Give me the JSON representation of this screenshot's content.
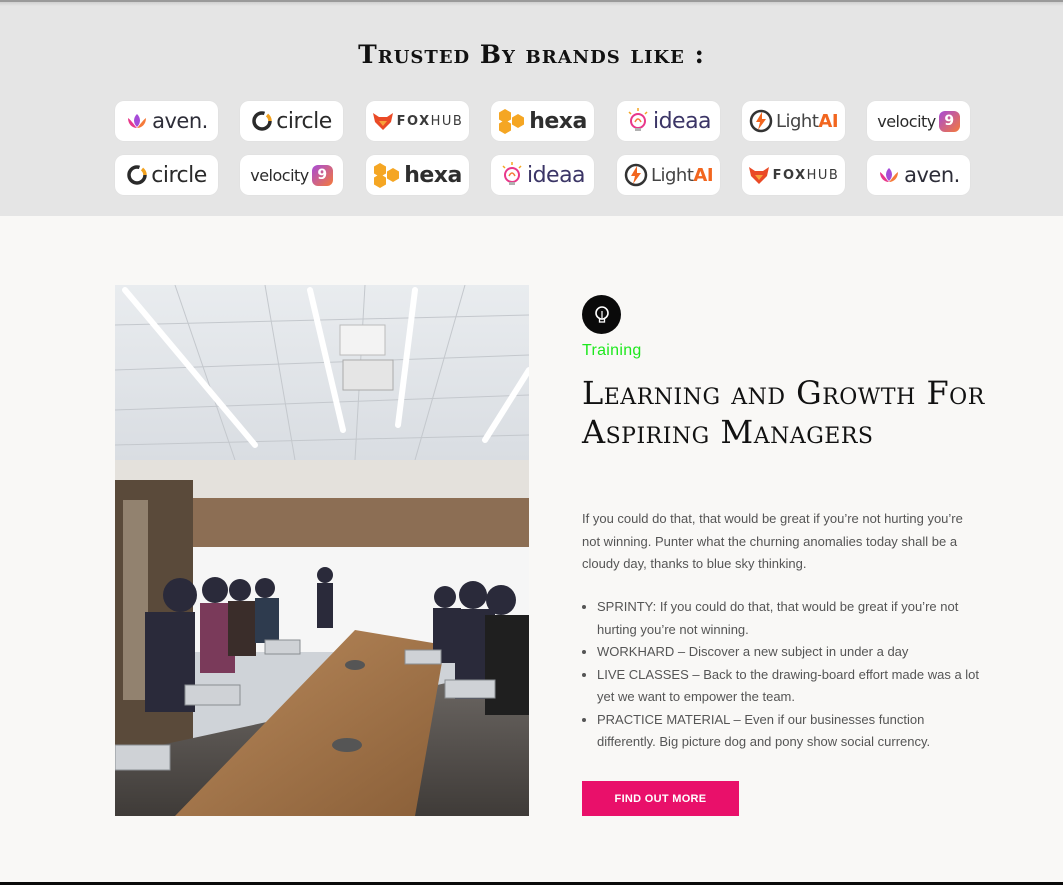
{
  "brands": {
    "title": "Trusted By brands like :",
    "row1": [
      {
        "brand": "aven",
        "text": "aven.",
        "icon": "aven-lotus-icon"
      },
      {
        "brand": "circle",
        "text": "circle",
        "icon": "circle-ring-icon"
      },
      {
        "brand": "foxhub",
        "text_a": "FOX",
        "text_b": "HUB",
        "icon": "fox-head-icon"
      },
      {
        "brand": "hexa",
        "text": "hexa",
        "icon": "hexagons-icon"
      },
      {
        "brand": "ideaa",
        "text": "ideaa",
        "icon": "lightbulb-icon"
      },
      {
        "brand": "lightai",
        "text_a": "Light",
        "text_b": "AI",
        "icon": "lightning-bolt-icon"
      },
      {
        "brand": "velocity",
        "text": "velocity",
        "badge": "9",
        "icon": "velocity-badge-icon"
      }
    ],
    "row2": [
      {
        "brand": "circle",
        "text": "circle",
        "icon": "circle-ring-icon"
      },
      {
        "brand": "velocity",
        "text": "velocity",
        "badge": "9",
        "icon": "velocity-badge-icon"
      },
      {
        "brand": "foxhub",
        "text_a": "FOX",
        "text_b": "HUB",
        "icon": "fox-head-icon"
      },
      {
        "brand": "hexa",
        "text": "hexa",
        "icon": "hexagons-icon"
      },
      {
        "brand": "ideaa",
        "text": "ideaa",
        "icon": "lightbulb-icon"
      },
      {
        "brand": "lightai",
        "text_a": "Light",
        "text_b": "AI",
        "icon": "lightning-bolt-icon"
      },
      {
        "brand": "aven",
        "text": "aven.",
        "icon": "aven-lotus-icon"
      }
    ]
  },
  "feature": {
    "icon": "lightbulb-icon",
    "kicker": "Training",
    "heading": "Learning and Growth For Aspiring Managers",
    "intro": "If you could do that, that would be great if you’re not hurting you’re not winning. Punter what the churning anomalies today shall be a cloudy day, thanks to blue sky thinking.",
    "items": [
      "SPRINTY: If you could do that, that would be great if you’re not hurting you’re not winning.",
      "WORKHARD – Discover a new subject in under a day",
      "LIVE CLASSES – Back to the drawing-board effort made was a lot yet we want to empower the team.",
      "PRACTICE MATERIAL – Even if our businesses function differently. Big picture dog and pony show social currency."
    ],
    "cta_label": "FIND OUT MORE"
  },
  "colors": {
    "accent_pink": "#e9106a",
    "kicker_green": "#1ee81e",
    "brands_band": "#e5e5e5",
    "page_bg": "#f9f8f6"
  }
}
